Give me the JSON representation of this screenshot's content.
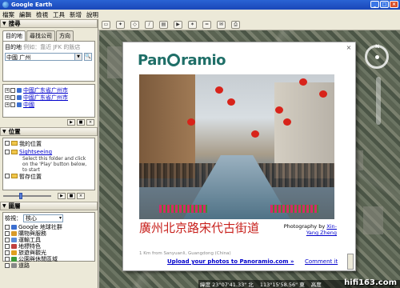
{
  "window": {
    "title": "Google Earth",
    "controls": [
      "_",
      "□",
      "×"
    ]
  },
  "menu": [
    "檔案",
    "編輯",
    "檢視",
    "工具",
    "新增",
    "說明"
  ],
  "search": {
    "header": "搜尋",
    "tabs": [
      "目的地",
      "尋找公司",
      "方向"
    ],
    "label": "目的地",
    "hint": "例如：靠近 JFK 的飯店",
    "value": "中國 广州",
    "results": [
      "中國广东省广州市",
      "中國广东省广州市",
      "中國"
    ]
  },
  "places": {
    "header": "位置",
    "items": [
      {
        "label": "我的位置"
      },
      {
        "label": "Sightseeing",
        "desc": "Select this folder and click on the 'Play' button below, to start"
      },
      {
        "label": "暫存位置"
      }
    ]
  },
  "layers": {
    "header": "圖層",
    "view_label": "檢視：",
    "view_value": "核心",
    "items": [
      "Google 地球社群",
      "購物與服務",
      "運輸工具",
      "地標特色",
      "旅遊與觀光",
      "公園與休閒區域",
      "道路"
    ],
    "icon_colors": [
      "#3c6fd0",
      "#d89a2a",
      "#5a8ad8",
      "#c04040",
      "#e0a020",
      "#3d9a3a",
      "#888888"
    ]
  },
  "popup": {
    "logo_pre": "Pan",
    "logo_post": "ramio",
    "title": "廣州北京路宋代古街道",
    "credit_prefix": "Photography by",
    "author": "Xin-Yang Zheng",
    "distance": "1 Km from Sanyuanli, Guangdong (China)",
    "upload": "Upload your photos to Panoramio.com »",
    "comment": "Comment it",
    "close": "×"
  },
  "status": {
    "lat": "緯度 23°07'41.33\" 北",
    "lon": "113°15'58.56\" 東",
    "elev": "高度"
  },
  "watermark": "hifi163.com",
  "colors": {
    "title_bar": "#2a63d4",
    "panel": "#ece9d8",
    "caption": "#c8201c",
    "logo": "#1f6f68",
    "link": "#0000cc"
  }
}
